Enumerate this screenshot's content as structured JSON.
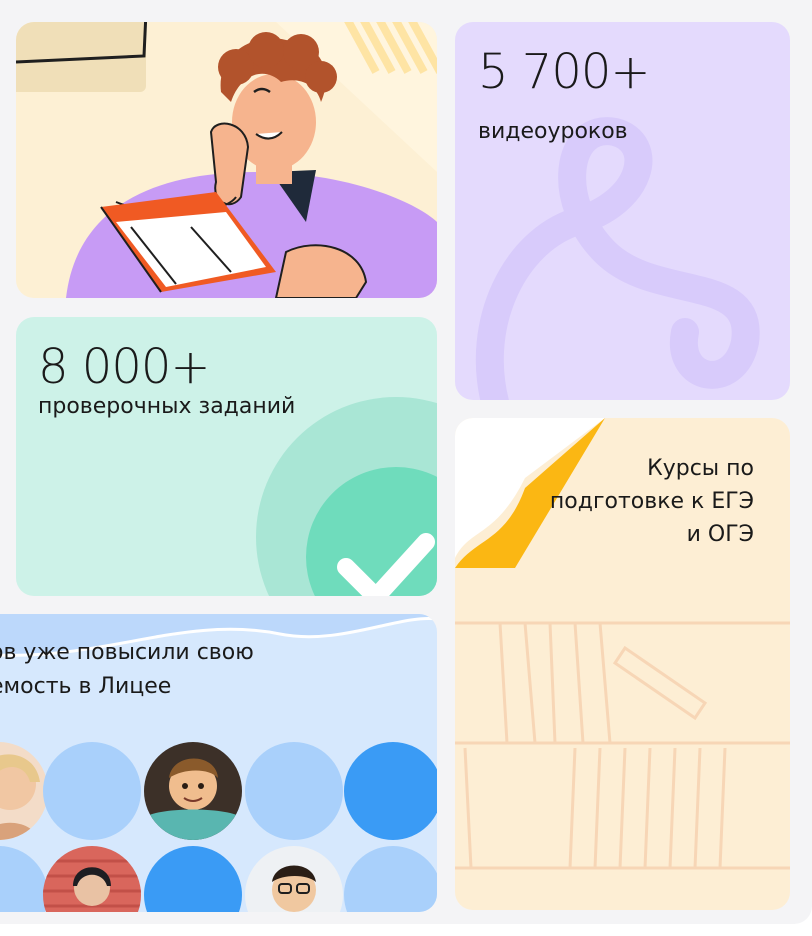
{
  "cards": {
    "videos": {
      "number": "5 700+",
      "caption": "видеоуроков"
    },
    "tasks": {
      "number": "8 000+",
      "caption": "проверочных заданий"
    },
    "courses": {
      "title": "Курсы по подготовке к ЕГЭ и ОГЭ"
    },
    "students": {
      "text": "ов уже повысили свою\nемость в Лицее"
    }
  },
  "icons": {
    "illustration": "student-reading-book-illustration",
    "videos_decoration": "loop-doodle-icon",
    "tasks_decoration": "checkmark-icon",
    "courses_decoration": "bookshelf-illustration",
    "students_avatars": "student-avatar-icon"
  },
  "colors": {
    "illustration_bg": "#fdf0d4",
    "videos_bg": "#e4dafd",
    "tasks_bg": "#cdf2e8",
    "courses_bg": "#fdeed4",
    "students_bg": "#d6e8fd",
    "accent_blue": "#3a9bf5",
    "accent_yellow": "#fbb713",
    "accent_green": "#6fdcbc"
  }
}
